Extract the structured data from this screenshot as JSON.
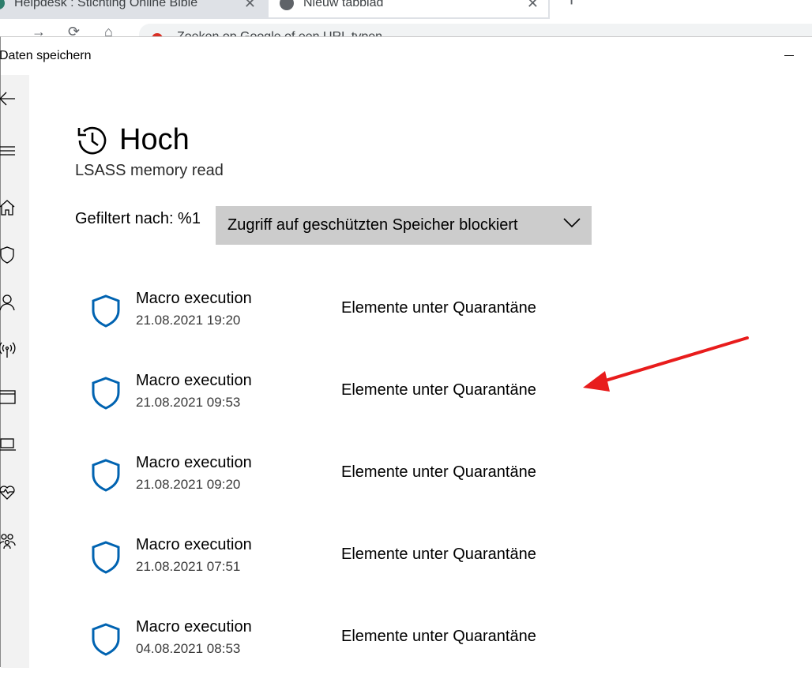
{
  "browser": {
    "tabs": [
      {
        "title": "Helpdesk : Stichting Online Bible"
      },
      {
        "title": "Nieuw tabblad"
      }
    ],
    "new_tab_glyph": "+",
    "omnibox_text": "Zoeken op Google of een URL typen"
  },
  "window": {
    "title": "Daten speichern",
    "minimize_label": "—"
  },
  "sidebar": {
    "items": [
      {
        "icon": "back-arrow-icon"
      },
      {
        "icon": "hamburger-menu-icon"
      },
      {
        "icon": "home-icon"
      },
      {
        "icon": "shield-icon"
      },
      {
        "icon": "person-icon"
      },
      {
        "icon": "wireless-icon"
      },
      {
        "icon": "app-browser-icon"
      },
      {
        "icon": "laptop-icon"
      },
      {
        "icon": "heart-pulse-icon"
      },
      {
        "icon": "family-icon"
      }
    ]
  },
  "page": {
    "title": "Hoch",
    "subtitle": "LSASS memory read",
    "filter_label": "Gefiltert nach: %1",
    "filter_value": "Zugriff auf geschützten Speicher blockiert"
  },
  "events": [
    {
      "name": "Macro execution",
      "date": "21.08.2021 19:20",
      "status": "Elemente unter Quarantäne"
    },
    {
      "name": "Macro execution",
      "date": "21.08.2021 09:53",
      "status": "Elemente unter Quarantäne"
    },
    {
      "name": "Macro execution",
      "date": "21.08.2021 09:20",
      "status": "Elemente unter Quarantäne"
    },
    {
      "name": "Macro execution",
      "date": "21.08.2021 07:51",
      "status": "Elemente unter Quarantäne"
    },
    {
      "name": "Macro execution",
      "date": "04.08.2021 08:53",
      "status": "Elemente unter Quarantäne"
    }
  ],
  "colors": {
    "accent": "#0063b1",
    "sidebar_bg": "#f2f2f2",
    "dropdown_bg": "#cccccc",
    "annotation": "#e81c1c"
  }
}
